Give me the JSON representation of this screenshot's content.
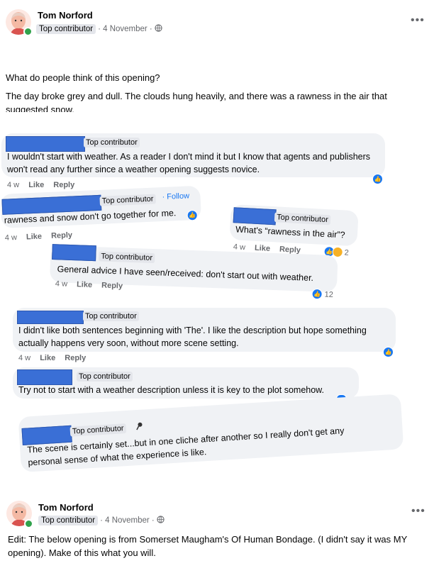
{
  "post1": {
    "author": "Tom Norford",
    "badge": "Top contributor",
    "date": "· 4 November ·",
    "question": "What do people think of this opening?",
    "excerpt": "The day broke grey and dull. The clouds hung heavily, and there was a rawness in the air that suggested snow."
  },
  "comments": [
    {
      "badge": "Top contributor",
      "text": "I wouldn't start with weather. As a reader I don't mind it but I know that agents and publishers won't read any further since a weather opening suggests novice.",
      "time": "4 w",
      "like": "Like",
      "reply": "Reply"
    },
    {
      "badge": "Top contributor",
      "follow": "· Follow",
      "text": "rawness and snow don't go together for me.",
      "time": "4 w",
      "like": "Like",
      "reply": "Reply"
    },
    {
      "badge": "Top contributor",
      "text": "What's “rawness in the air”?",
      "time": "4 w",
      "like": "Like",
      "reply": "Reply",
      "reactions": "2"
    },
    {
      "badge": "Top contributor",
      "text": "General advice I have seen/received: don't start out with weather.",
      "time": "4 w",
      "like": "Like",
      "reply": "Reply",
      "reactions": "12"
    },
    {
      "badge": "Top contributor",
      "text": "I didn't like both sentences beginning with 'The'. I like the description but hope something actually happens very soon, without more scene setting.",
      "time": "4 w",
      "like": "Like",
      "reply": "Reply"
    },
    {
      "badge": "Top contributor",
      "text": "Try not to start with a weather description unless it is key to the plot somehow."
    },
    {
      "badge": "Top contributor",
      "text": "The scene is certainly set...but in one cliche after another so I really don't get any personal sense of what the experience is like."
    }
  ],
  "post2": {
    "author": "Tom Norford",
    "badge": "Top contributor",
    "date": "· 4 November ·",
    "text": "Edit: The below opening is from Somerset Maugham's Of Human Bondage. (I didn't say it was MY opening). Make of this what you will."
  },
  "icons": [
    "globe-icon",
    "more-options-icon",
    "like-reaction-icon",
    "haha-reaction-icon",
    "pin-icon"
  ]
}
